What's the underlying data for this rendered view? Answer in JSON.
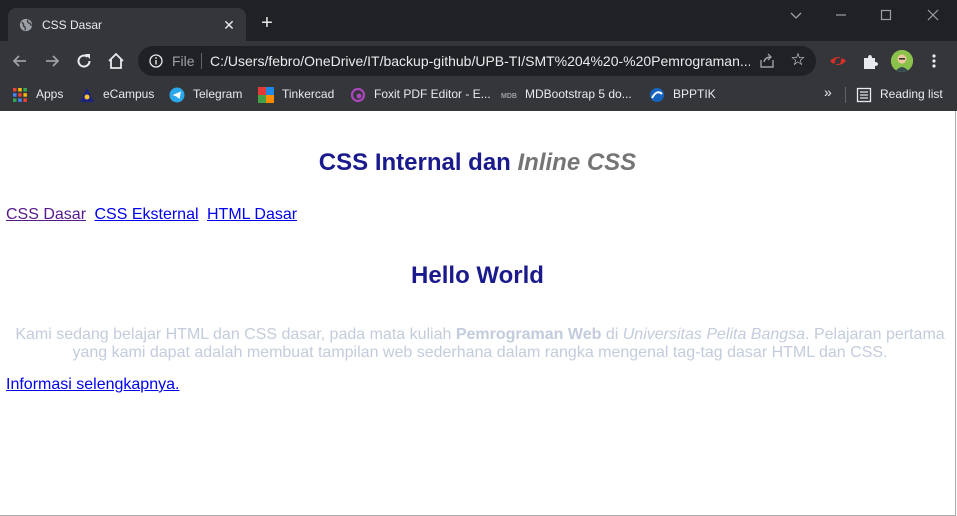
{
  "browser": {
    "tab": {
      "title": "CSS Dasar",
      "favicon": "globe-icon"
    },
    "address": {
      "scheme_label": "File",
      "url": "C:/Users/febro/OneDrive/IT/backup-github/UPB-TI/SMT%204%20-%20Pemrograman..."
    },
    "bookmarks": [
      {
        "label": "Apps",
        "icon": "apps-grid-icon"
      },
      {
        "label": "eCampus",
        "icon": "ecampus-icon"
      },
      {
        "label": "Telegram",
        "icon": "telegram-icon"
      },
      {
        "label": "Tinkercad",
        "icon": "tinkercad-icon"
      },
      {
        "label": "Foxit PDF Editor - E...",
        "icon": "foxit-icon"
      },
      {
        "label": "MDBootstrap 5 do...",
        "icon": "mdb-icon"
      },
      {
        "label": "BPPTIK",
        "icon": "bpptik-icon"
      }
    ],
    "reading_list": "Reading list",
    "colors": {
      "frame": "#202124",
      "toolbar": "#35363a",
      "omnibox": "#202124"
    }
  },
  "page": {
    "title_main": "CSS Internal dan ",
    "title_inline": "Inline CSS",
    "nav_links": [
      {
        "label": "CSS Dasar",
        "state": "visited"
      },
      {
        "label": "CSS Eksternal",
        "state": "unvisited"
      },
      {
        "label": "HTML Dasar",
        "state": "unvisited"
      }
    ],
    "hello": "Hello World",
    "paragraph": {
      "part1": "Kami sedang belajar HTML dan CSS dasar, pada mata kuliah ",
      "bold": "Pemrograman Web",
      "part2": " di ",
      "italic": "Universitas Pelita Bangsa",
      "part3": ". Pelajaran pertama yang kami dapat adalah membuat tampilan web sederhana dalam rangka mengenal tag-tag dasar HTML dan CSS."
    },
    "more_link": "Informasi selengkapnya.",
    "colors": {
      "heading": "#1a1a8c",
      "inline_css": "#757575",
      "paragraph": "#c3ccdc"
    }
  }
}
